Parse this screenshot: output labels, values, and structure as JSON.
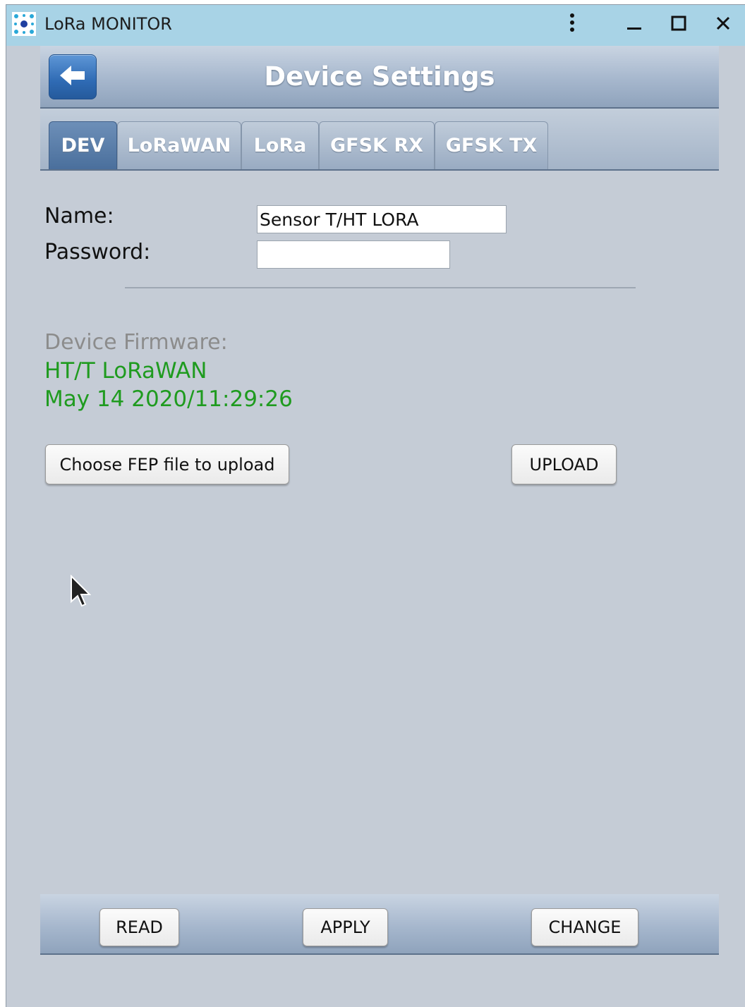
{
  "window": {
    "title": "LoRa MONITOR"
  },
  "titlebar_buttons": {
    "menu_icon": "vertical-ellipsis-icon",
    "minimize_icon": "minimize-icon",
    "maximize_icon": "maximize-icon",
    "close_icon": "close-icon"
  },
  "header": {
    "title": "Device Settings",
    "back_icon": "arrow-left-icon"
  },
  "tabs": [
    {
      "label": "DEV",
      "active": true
    },
    {
      "label": "LoRaWAN",
      "active": false
    },
    {
      "label": "LoRa",
      "active": false
    },
    {
      "label": "GFSK RX",
      "active": false
    },
    {
      "label": "GFSK TX",
      "active": false
    }
  ],
  "form": {
    "name_label": "Name:",
    "name_value": "Sensor T/HT LORA",
    "password_label": "Password:",
    "password_value": ""
  },
  "firmware": {
    "label": "Device Firmware:",
    "name": "HT/T LoRaWAN",
    "build": "May 14 2020/11:29:26"
  },
  "upload": {
    "choose_label": "Choose FEP file to upload",
    "upload_label": "UPLOAD"
  },
  "bottom": {
    "read_label": "READ",
    "apply_label": "APPLY",
    "change_label": "CHANGE"
  },
  "colors": {
    "titlebar": "#a8d3e6",
    "window_bg": "#c5ccd6",
    "active_tab": "#4a6f9c",
    "firmware_text": "#1f9b1f",
    "firmware_label": "#8c8c8c"
  }
}
